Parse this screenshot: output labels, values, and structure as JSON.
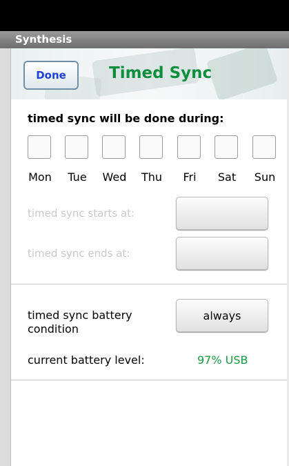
{
  "window": {
    "app_title": "Synthesis"
  },
  "header": {
    "done_label": "Done",
    "title": "Timed Sync"
  },
  "sync_days": {
    "heading": "timed sync will be done during:",
    "days": [
      {
        "label": "Mon",
        "checked": false
      },
      {
        "label": "Tue",
        "checked": false
      },
      {
        "label": "Wed",
        "checked": false
      },
      {
        "label": "Thu",
        "checked": false
      },
      {
        "label": "Fri",
        "checked": false
      },
      {
        "label": "Sat",
        "checked": false
      },
      {
        "label": "Sun",
        "checked": false
      }
    ]
  },
  "time_range": {
    "starts_label": "timed sync starts at:",
    "starts_value": "",
    "ends_label": "timed sync ends at:",
    "ends_value": ""
  },
  "battery": {
    "condition_label": "timed sync battery condition",
    "condition_value": "always",
    "current_label": "current battery level:",
    "current_value": "97% USB"
  },
  "colors": {
    "title_green": "#0f8f3d",
    "done_blue": "#1c3fd6",
    "battery_green": "#1a9a44",
    "disabled_gray": "#c9c9c9"
  }
}
